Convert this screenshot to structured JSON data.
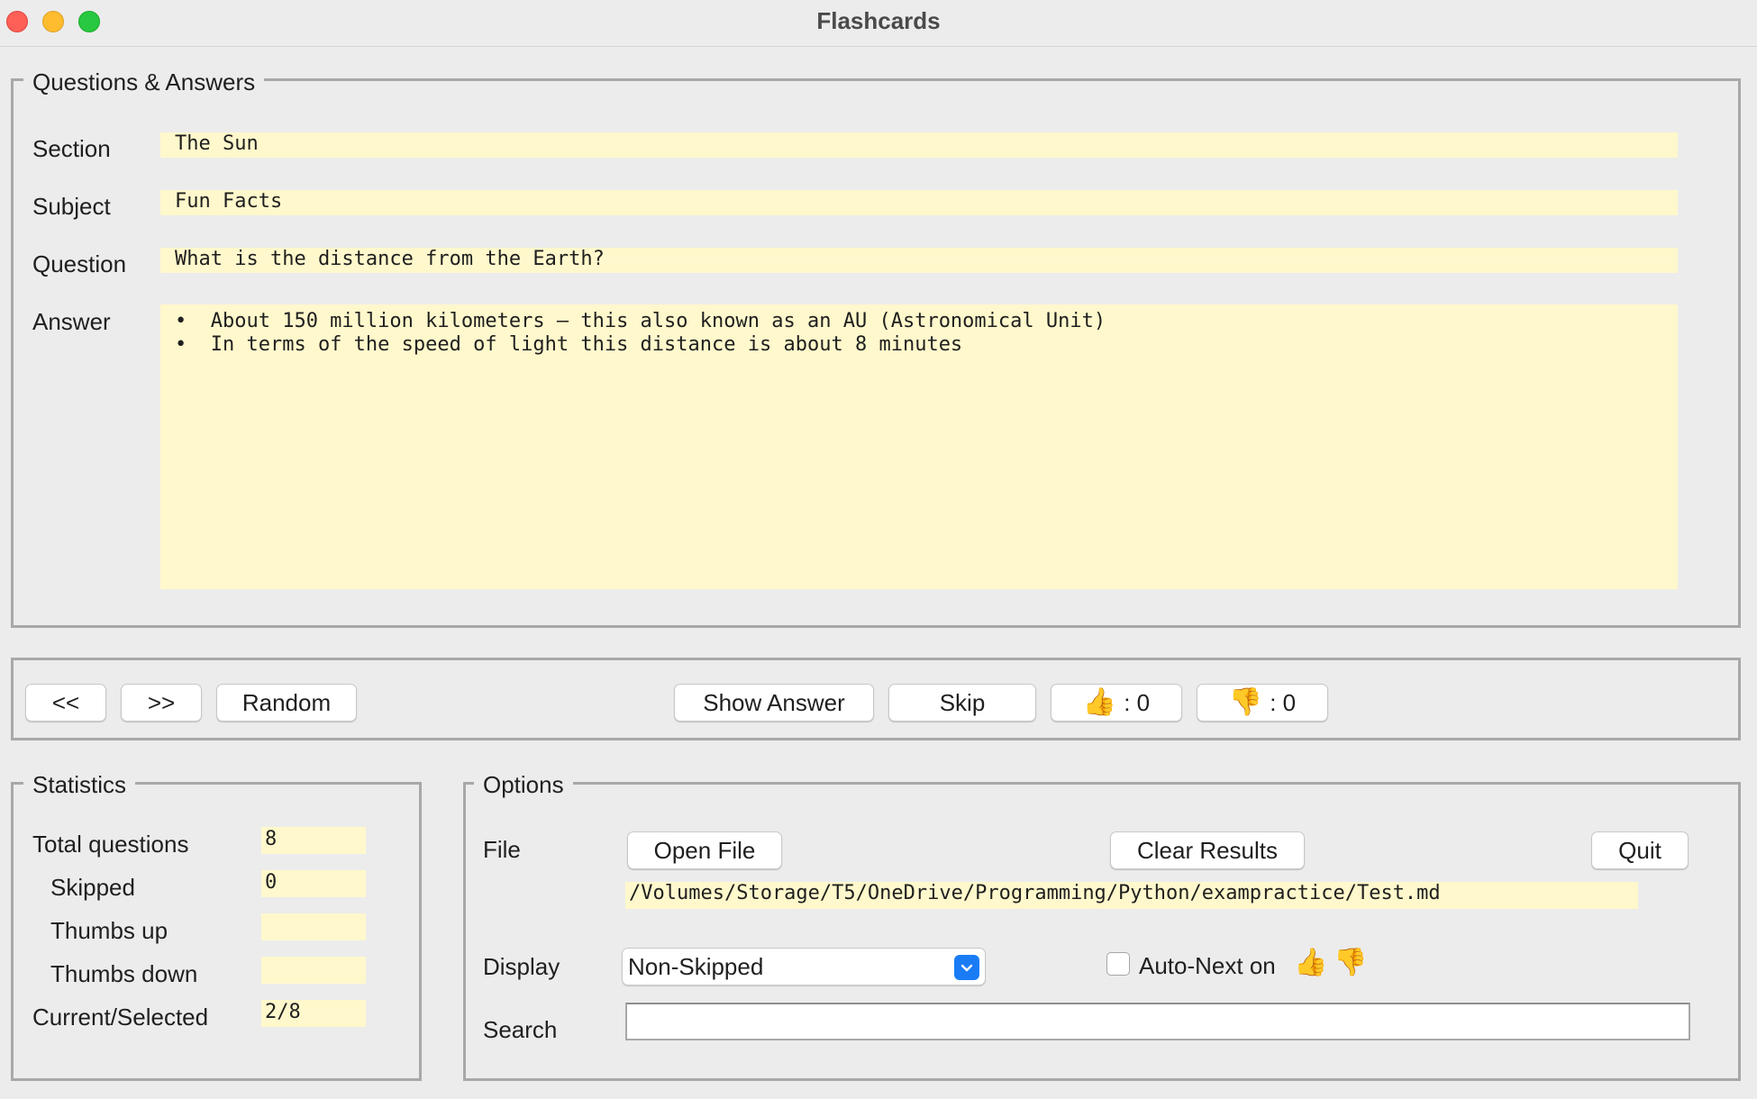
{
  "window": {
    "title": "Flashcards"
  },
  "qa": {
    "legend": "Questions & Answers",
    "section_label": "Section",
    "section_value": "The Sun",
    "subject_label": "Subject",
    "subject_value": "Fun Facts",
    "question_label": "Question",
    "question_value": "What is the distance from the Earth?",
    "answer_label": "Answer",
    "answer_lines": [
      "•  About 150 million kilometers – this also known as an AU (Astronomical Unit)",
      "•  In terms of the speed of light this distance is about 8 minutes"
    ]
  },
  "nav": {
    "prev_label": "<<",
    "next_label": ">>",
    "random_label": "Random",
    "show_answer_label": "Show Answer",
    "skip_label": "Skip",
    "thumbs_up_emoji": "👍",
    "thumbs_up_count": ": 0",
    "thumbs_down_emoji": "👎",
    "thumbs_down_count": ": 0"
  },
  "statistics": {
    "legend": "Statistics",
    "total_label": "Total questions",
    "total_value": "8",
    "skipped_label": "Skipped",
    "skipped_value": "0",
    "thumbs_up_label": "Thumbs up",
    "thumbs_up_value": "",
    "thumbs_down_label": "Thumbs down",
    "thumbs_down_value": "",
    "current_label": "Current/Selected",
    "current_value": "2/8"
  },
  "options": {
    "legend": "Options",
    "file_label": "File",
    "open_file_label": "Open File",
    "clear_results_label": "Clear Results",
    "quit_label": "Quit",
    "file_path": "/Volumes/Storage/T5/OneDrive/Programming/Python/exampractice/Test.md",
    "display_label": "Display",
    "display_selected": "Non-Skipped",
    "auto_next_label": "Auto-Next on",
    "auto_next_checked": false,
    "auto_next_emoji_up": "👍",
    "auto_next_emoji_down": "👎",
    "search_label": "Search",
    "search_value": ""
  },
  "colors": {
    "entry_background": "#fff8cc",
    "window_background": "#ececec",
    "accent": "#1a7cf5"
  }
}
